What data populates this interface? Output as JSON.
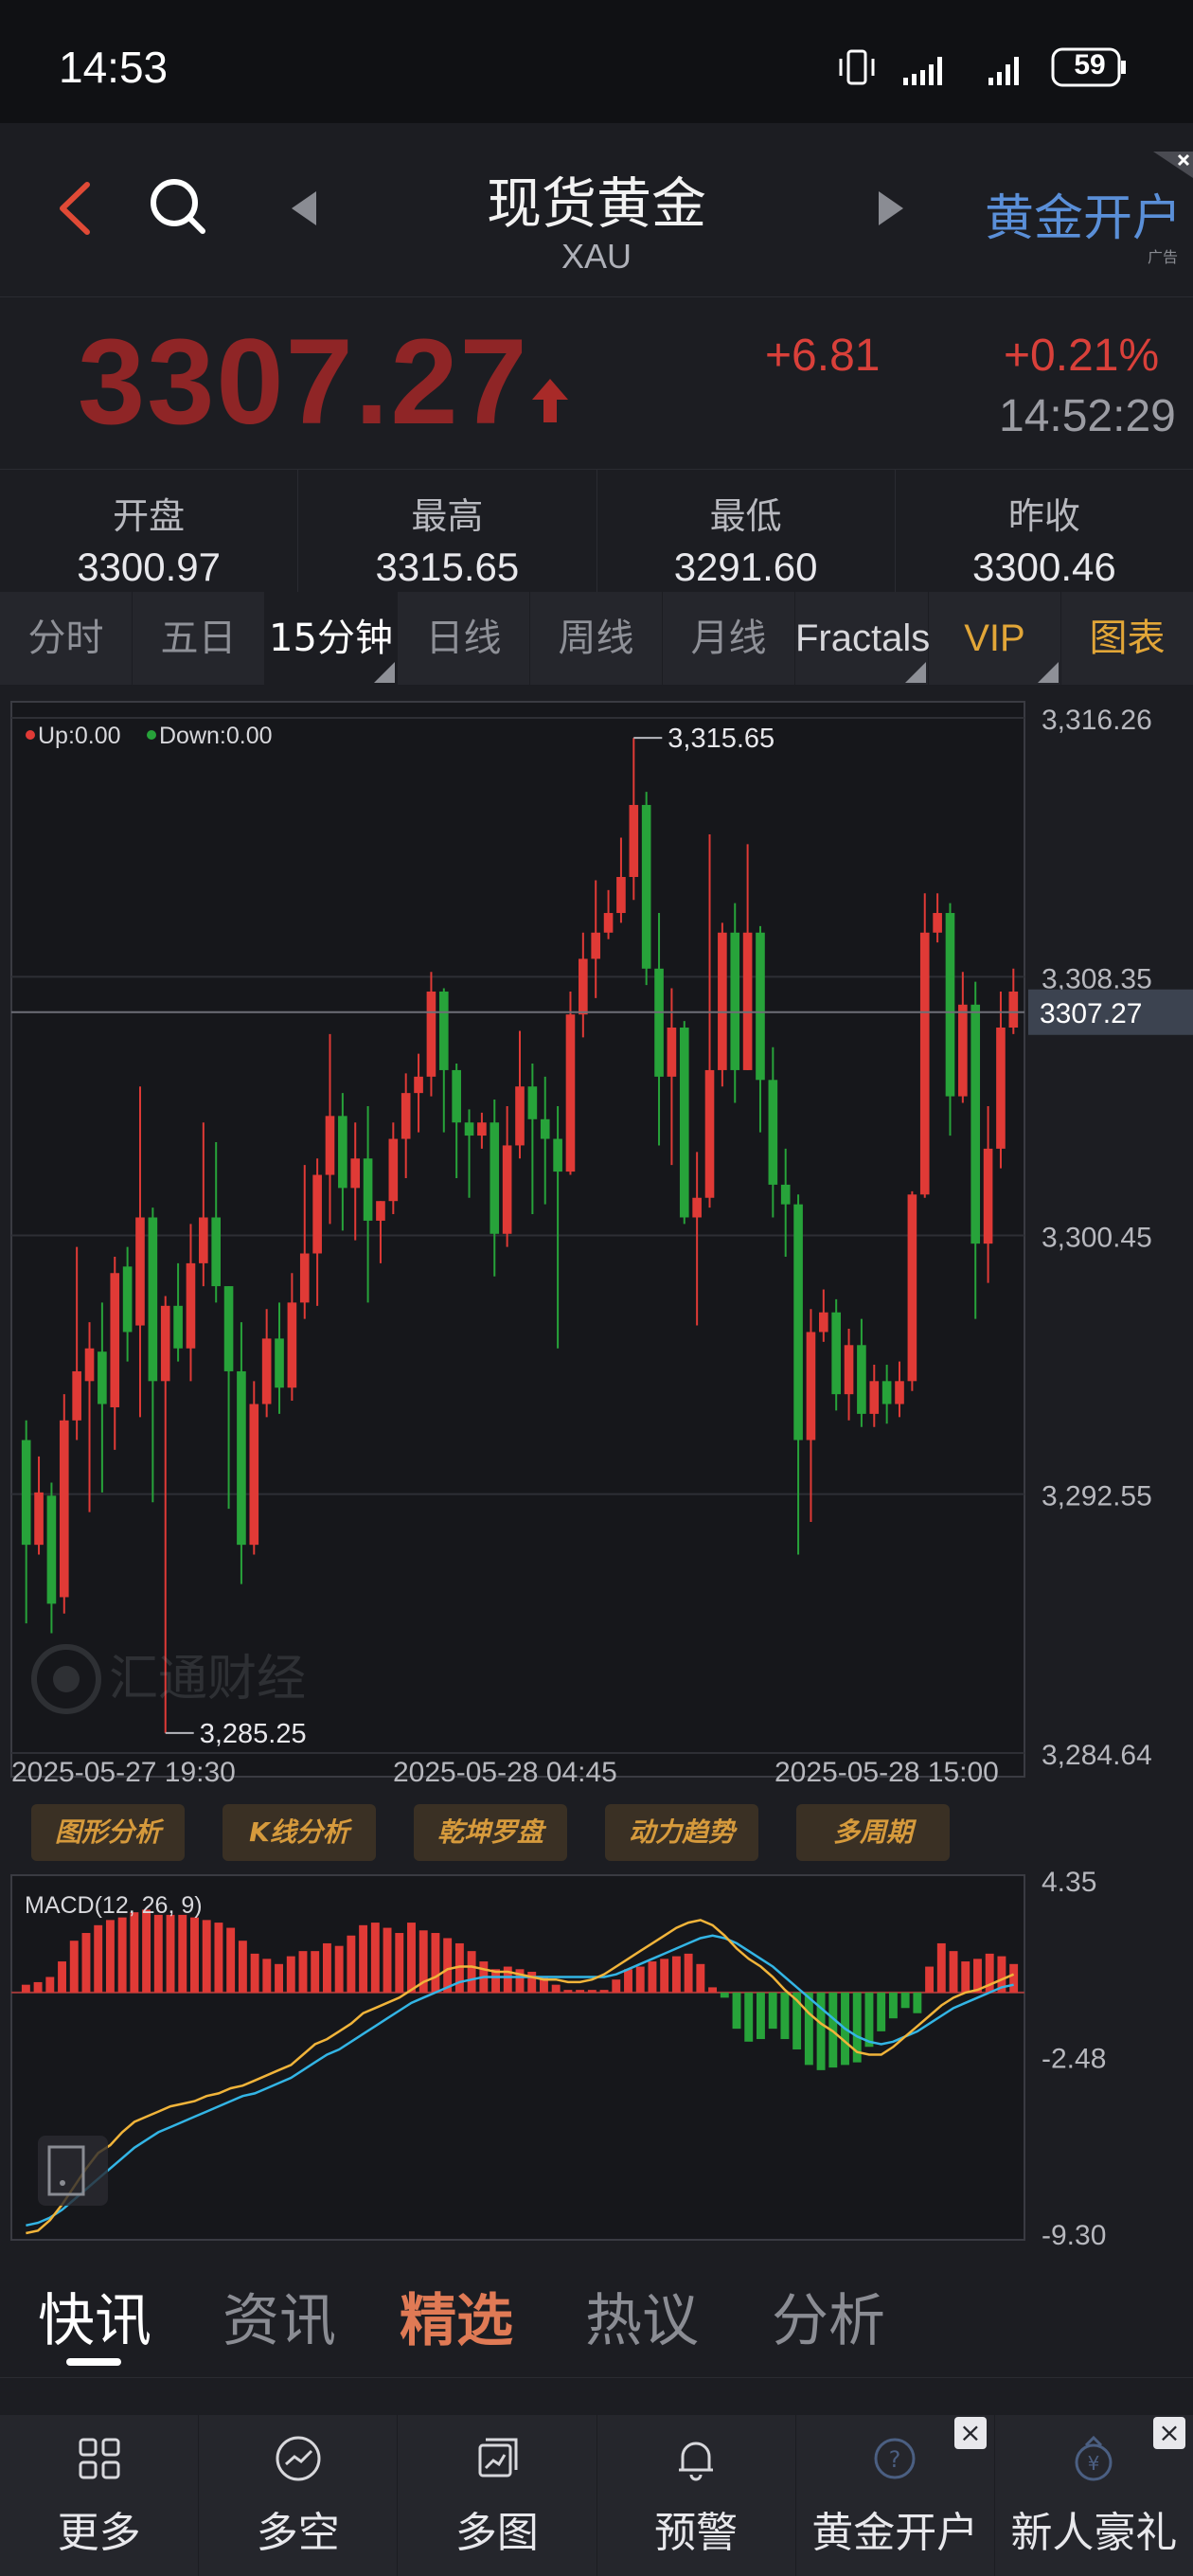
{
  "status_bar": {
    "time": "14:53",
    "battery": "59",
    "icons": [
      "vibrate-icon",
      "signal-icon",
      "signal-icon",
      "battery-icon"
    ]
  },
  "header": {
    "title": "现货黄金",
    "subtitle": "XAU",
    "ad_link": "黄金开户",
    "ad_tag": "广告"
  },
  "price": {
    "value": "3307.27",
    "change": "+6.81",
    "percent": "+0.21%",
    "time": "14:52:29",
    "colors": {
      "value": "#8f2526",
      "change": "#d9403a"
    }
  },
  "stats": [
    {
      "label": "开盘",
      "value": "3300.97"
    },
    {
      "label": "最高",
      "value": "3315.65"
    },
    {
      "label": "最低",
      "value": "3291.60"
    },
    {
      "label": "昨收",
      "value": "3300.46"
    }
  ],
  "tabs": [
    {
      "label": "分时"
    },
    {
      "label": "五日"
    },
    {
      "label": "15分钟"
    },
    {
      "label": "日线"
    },
    {
      "label": "周线"
    },
    {
      "label": "月线"
    },
    {
      "label": "Fractals"
    },
    {
      "label": "VIP"
    },
    {
      "label": "图表"
    }
  ],
  "active_tab": "15分钟",
  "chart_data": [
    {
      "type": "candlestick",
      "legend": [
        "Up:0.00",
        "Down:0.00"
      ],
      "y_ticks": [
        "3,316.26",
        "3,308.35",
        "3,300.45",
        "3,292.55",
        "3,284.64"
      ],
      "ylim": [
        3284.64,
        3316.26
      ],
      "current_price_label": "3307.27",
      "high_label": "3,315.65",
      "low_label": "3,285.25",
      "x_labels": [
        "2025-05-27 19:30",
        "2025-05-28 04:45",
        "2025-05-28 15:00"
      ],
      "candles": [
        {
          "o": 3294.2,
          "c": 3291.0,
          "h": 3294.8,
          "l": 3288.6
        },
        {
          "o": 3291.0,
          "c": 3292.6,
          "h": 3293.7,
          "l": 3290.7
        },
        {
          "o": 3292.5,
          "c": 3289.2,
          "h": 3292.9,
          "l": 3288.3
        },
        {
          "o": 3289.4,
          "c": 3294.8,
          "h": 3295.6,
          "l": 3288.9
        },
        {
          "o": 3294.8,
          "c": 3296.3,
          "h": 3300.1,
          "l": 3294.2
        },
        {
          "o": 3296.0,
          "c": 3297.0,
          "h": 3297.8,
          "l": 3292.0
        },
        {
          "o": 3296.9,
          "c": 3295.3,
          "h": 3298.4,
          "l": 3292.6
        },
        {
          "o": 3295.2,
          "c": 3299.3,
          "h": 3299.8,
          "l": 3293.9
        },
        {
          "o": 3299.5,
          "c": 3297.5,
          "h": 3300.1,
          "l": 3296.6
        },
        {
          "o": 3297.7,
          "c": 3301.0,
          "h": 3305.0,
          "l": 3294.9
        },
        {
          "o": 3301.0,
          "c": 3296.0,
          "h": 3301.3,
          "l": 3292.3
        },
        {
          "o": 3296.0,
          "c": 3298.3,
          "h": 3298.6,
          "l": 3285.25
        },
        {
          "o": 3298.3,
          "c": 3297.0,
          "h": 3299.6,
          "l": 3296.6
        },
        {
          "o": 3297.0,
          "c": 3299.6,
          "h": 3300.8,
          "l": 3296.0
        },
        {
          "o": 3299.6,
          "c": 3301.0,
          "h": 3303.9,
          "l": 3298.9
        },
        {
          "o": 3301.0,
          "c": 3298.9,
          "h": 3303.3,
          "l": 3298.4
        },
        {
          "o": 3298.9,
          "c": 3296.3,
          "h": 3298.9,
          "l": 3292.1
        },
        {
          "o": 3296.3,
          "c": 3291.0,
          "h": 3297.8,
          "l": 3289.8
        },
        {
          "o": 3291.0,
          "c": 3295.3,
          "h": 3296.0,
          "l": 3290.7
        },
        {
          "o": 3295.3,
          "c": 3297.3,
          "h": 3298.2,
          "l": 3294.9
        },
        {
          "o": 3297.3,
          "c": 3295.8,
          "h": 3298.4,
          "l": 3295.0
        },
        {
          "o": 3295.8,
          "c": 3298.4,
          "h": 3299.3,
          "l": 3295.4
        },
        {
          "o": 3298.4,
          "c": 3299.9,
          "h": 3302.6,
          "l": 3297.9
        },
        {
          "o": 3299.9,
          "c": 3302.3,
          "h": 3302.8,
          "l": 3298.3
        },
        {
          "o": 3302.3,
          "c": 3304.1,
          "h": 3306.6,
          "l": 3300.8
        },
        {
          "o": 3304.1,
          "c": 3301.9,
          "h": 3304.8,
          "l": 3300.6
        },
        {
          "o": 3301.9,
          "c": 3302.8,
          "h": 3303.9,
          "l": 3300.3
        },
        {
          "o": 3302.8,
          "c": 3300.9,
          "h": 3304.4,
          "l": 3298.4
        },
        {
          "o": 3300.9,
          "c": 3301.5,
          "h": 3301.5,
          "l": 3299.6
        },
        {
          "o": 3301.5,
          "c": 3303.4,
          "h": 3303.9,
          "l": 3301.1
        },
        {
          "o": 3303.4,
          "c": 3304.8,
          "h": 3305.4,
          "l": 3302.2
        },
        {
          "o": 3304.8,
          "c": 3305.3,
          "h": 3306.0,
          "l": 3303.6
        },
        {
          "o": 3305.3,
          "c": 3307.9,
          "h": 3308.5,
          "l": 3304.7
        },
        {
          "o": 3307.9,
          "c": 3305.5,
          "h": 3308.0,
          "l": 3303.6
        },
        {
          "o": 3305.5,
          "c": 3303.9,
          "h": 3305.7,
          "l": 3302.2
        },
        {
          "o": 3303.9,
          "c": 3303.5,
          "h": 3304.3,
          "l": 3301.6
        },
        {
          "o": 3303.5,
          "c": 3303.9,
          "h": 3304.2,
          "l": 3303.1
        },
        {
          "o": 3303.9,
          "c": 3300.5,
          "h": 3304.6,
          "l": 3299.2
        },
        {
          "o": 3300.5,
          "c": 3303.2,
          "h": 3304.4,
          "l": 3300.1
        },
        {
          "o": 3303.2,
          "c": 3305.0,
          "h": 3306.7,
          "l": 3302.8
        },
        {
          "o": 3305.0,
          "c": 3304.0,
          "h": 3305.7,
          "l": 3301.1
        },
        {
          "o": 3304.0,
          "c": 3303.4,
          "h": 3305.3,
          "l": 3301.4
        },
        {
          "o": 3303.4,
          "c": 3302.4,
          "h": 3304.4,
          "l": 3297.0
        },
        {
          "o": 3302.4,
          "c": 3307.2,
          "h": 3307.9,
          "l": 3302.3
        },
        {
          "o": 3307.2,
          "c": 3308.9,
          "h": 3309.7,
          "l": 3306.5
        },
        {
          "o": 3308.9,
          "c": 3309.7,
          "h": 3311.3,
          "l": 3307.7
        },
        {
          "o": 3309.7,
          "c": 3310.3,
          "h": 3311.0,
          "l": 3309.5
        },
        {
          "o": 3310.3,
          "c": 3311.4,
          "h": 3312.6,
          "l": 3310.0
        },
        {
          "o": 3311.4,
          "c": 3313.6,
          "h": 3315.65,
          "l": 3310.7
        },
        {
          "o": 3313.6,
          "c": 3308.6,
          "h": 3314.0,
          "l": 3308.1
        },
        {
          "o": 3308.6,
          "c": 3305.3,
          "h": 3310.3,
          "l": 3303.2
        },
        {
          "o": 3305.3,
          "c": 3306.8,
          "h": 3308.0,
          "l": 3302.6
        },
        {
          "o": 3306.8,
          "c": 3301.0,
          "h": 3307.0,
          "l": 3300.8
        },
        {
          "o": 3301.0,
          "c": 3301.6,
          "h": 3303.0,
          "l": 3297.7
        },
        {
          "o": 3301.6,
          "c": 3305.5,
          "h": 3312.7,
          "l": 3301.3
        },
        {
          "o": 3305.5,
          "c": 3309.7,
          "h": 3310.0,
          "l": 3305.0
        },
        {
          "o": 3309.7,
          "c": 3305.5,
          "h": 3310.6,
          "l": 3304.5
        },
        {
          "o": 3305.5,
          "c": 3309.7,
          "h": 3312.4,
          "l": 3305.5
        },
        {
          "o": 3309.7,
          "c": 3305.2,
          "h": 3309.9,
          "l": 3303.6
        },
        {
          "o": 3305.2,
          "c": 3302.0,
          "h": 3306.2,
          "l": 3301.0
        },
        {
          "o": 3302.0,
          "c": 3301.4,
          "h": 3303.1,
          "l": 3299.8
        },
        {
          "o": 3301.4,
          "c": 3294.2,
          "h": 3301.7,
          "l": 3290.7
        },
        {
          "o": 3294.2,
          "c": 3297.5,
          "h": 3298.2,
          "l": 3291.7
        },
        {
          "o": 3297.5,
          "c": 3298.1,
          "h": 3298.8,
          "l": 3297.2
        },
        {
          "o": 3298.1,
          "c": 3295.6,
          "h": 3298.5,
          "l": 3295.1
        },
        {
          "o": 3295.6,
          "c": 3297.1,
          "h": 3297.6,
          "l": 3294.8
        },
        {
          "o": 3297.1,
          "c": 3295.0,
          "h": 3297.9,
          "l": 3294.6
        },
        {
          "o": 3295.0,
          "c": 3296.0,
          "h": 3296.5,
          "l": 3294.6
        },
        {
          "o": 3296.0,
          "c": 3295.3,
          "h": 3296.5,
          "l": 3294.7
        },
        {
          "o": 3295.3,
          "c": 3296.0,
          "h": 3296.6,
          "l": 3294.9
        },
        {
          "o": 3296.0,
          "c": 3301.7,
          "h": 3301.8,
          "l": 3295.7
        },
        {
          "o": 3301.7,
          "c": 3309.7,
          "h": 3310.9,
          "l": 3301.6
        },
        {
          "o": 3309.7,
          "c": 3310.3,
          "h": 3310.9,
          "l": 3309.4
        },
        {
          "o": 3310.3,
          "c": 3304.7,
          "h": 3310.6,
          "l": 3303.5
        },
        {
          "o": 3304.7,
          "c": 3307.5,
          "h": 3308.5,
          "l": 3304.5
        },
        {
          "o": 3307.5,
          "c": 3300.2,
          "h": 3308.2,
          "l": 3297.9
        },
        {
          "o": 3300.2,
          "c": 3303.1,
          "h": 3304.4,
          "l": 3299.0
        },
        {
          "o": 3303.1,
          "c": 3306.8,
          "h": 3307.9,
          "l": 3302.5
        },
        {
          "o": 3306.8,
          "c": 3307.9,
          "h": 3308.6,
          "l": 3306.6
        }
      ]
    },
    {
      "type": "bar",
      "name": "MACD(12, 26, 9)",
      "y_ticks": [
        "4.35",
        "-2.48",
        "-9.30"
      ],
      "ylim": [
        -9.3,
        4.35
      ],
      "histogram": [
        0.3,
        0.4,
        0.6,
        1.2,
        2.0,
        2.3,
        2.6,
        2.8,
        2.9,
        3.1,
        3.2,
        3.0,
        3.0,
        3.0,
        2.9,
        2.8,
        2.7,
        2.5,
        2.0,
        1.5,
        1.3,
        1.1,
        1.4,
        1.6,
        1.6,
        1.9,
        1.8,
        2.2,
        2.6,
        2.7,
        2.5,
        2.3,
        2.7,
        2.4,
        2.3,
        2.1,
        1.9,
        1.6,
        1.2,
        0.9,
        1.0,
        0.9,
        0.8,
        0.6,
        0.3,
        0.1,
        0.1,
        0.1,
        0.1,
        0.5,
        0.9,
        1.0,
        1.2,
        1.3,
        1.4,
        1.5,
        1.1,
        0.2,
        -0.2,
        -1.4,
        -1.9,
        -1.8,
        -1.4,
        -1.8,
        -2.2,
        -2.8,
        -3.0,
        -2.9,
        -2.8,
        -2.7,
        -2.1,
        -1.5,
        -1.0,
        -0.6,
        -0.8,
        1.0,
        1.9,
        1.6,
        1.2,
        1.3,
        1.5,
        1.4,
        1.1
      ],
      "dif": [
        -9.3,
        -9.2,
        -8.8,
        -8.2,
        -7.5,
        -6.8,
        -6.2,
        -5.9,
        -5.4,
        -5.0,
        -4.8,
        -4.6,
        -4.4,
        -4.3,
        -4.2,
        -4.0,
        -3.9,
        -3.7,
        -3.6,
        -3.4,
        -3.2,
        -3.0,
        -2.8,
        -2.4,
        -2.0,
        -1.8,
        -1.5,
        -1.2,
        -0.8,
        -0.6,
        -0.4,
        -0.2,
        0.1,
        0.4,
        0.6,
        0.9,
        1.0,
        1.0,
        0.9,
        0.8,
        0.8,
        0.7,
        0.6,
        0.5,
        0.5,
        0.4,
        0.4,
        0.5,
        0.7,
        1.0,
        1.3,
        1.6,
        1.9,
        2.2,
        2.5,
        2.7,
        2.8,
        2.6,
        2.2,
        1.7,
        1.3,
        1.0,
        0.6,
        0.1,
        -0.3,
        -0.8,
        -1.2,
        -1.5,
        -1.9,
        -2.3,
        -2.4,
        -2.4,
        -2.1,
        -1.7,
        -1.3,
        -0.9,
        -0.5,
        -0.2,
        0.0,
        0.1,
        0.3,
        0.5,
        0.7
      ],
      "dea": [
        -9.0,
        -8.9,
        -8.7,
        -8.4,
        -8.0,
        -7.6,
        -7.2,
        -6.8,
        -6.4,
        -6.0,
        -5.7,
        -5.4,
        -5.2,
        -5.0,
        -4.8,
        -4.6,
        -4.4,
        -4.2,
        -4.0,
        -3.9,
        -3.7,
        -3.5,
        -3.3,
        -3.0,
        -2.7,
        -2.4,
        -2.2,
        -1.9,
        -1.6,
        -1.3,
        -1.0,
        -0.7,
        -0.4,
        -0.2,
        0.0,
        0.2,
        0.4,
        0.5,
        0.6,
        0.6,
        0.6,
        0.6,
        0.6,
        0.6,
        0.6,
        0.6,
        0.6,
        0.6,
        0.6,
        0.7,
        0.9,
        1.1,
        1.3,
        1.5,
        1.7,
        1.9,
        2.1,
        2.2,
        2.1,
        1.9,
        1.6,
        1.3,
        1.0,
        0.6,
        0.2,
        -0.2,
        -0.6,
        -1.0,
        -1.4,
        -1.7,
        -1.9,
        -2.0,
        -1.9,
        -1.7,
        -1.5,
        -1.2,
        -0.9,
        -0.6,
        -0.4,
        -0.2,
        0.0,
        0.2,
        0.3
      ]
    }
  ],
  "analysis_tags": [
    "图形分析",
    "K线分析",
    "乾坤罗盘",
    "动力趋势",
    "多周期"
  ],
  "news_tabs": [
    "快讯",
    "资讯",
    "精选",
    "热议",
    "分析"
  ],
  "bottom_nav": [
    {
      "label": "更多",
      "icon": "grid-icon"
    },
    {
      "label": "多空",
      "icon": "trend-icon"
    },
    {
      "label": "多图",
      "icon": "multi-chart-icon"
    },
    {
      "label": "预警",
      "icon": "bell-icon"
    },
    {
      "label": "黄金开户",
      "icon": "gold-account-icon"
    },
    {
      "label": "新人豪礼",
      "icon": "gift-icon"
    }
  ],
  "colors": {
    "up": "#e03a36",
    "down": "#27a33a",
    "dif": "#f1b43a",
    "dea": "#33b5e5",
    "accent": "#e2a638"
  }
}
